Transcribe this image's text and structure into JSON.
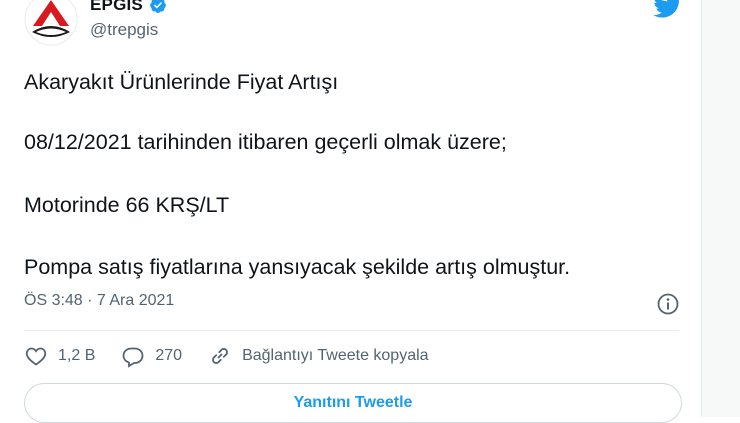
{
  "tweet": {
    "author_name": "EPGIS",
    "author_handle": "@trepgis",
    "lines": [
      "Akaryakıt Ürünlerinde Fiyat Artışı",
      "08/12/2021 tarihinden itibaren geçerli olmak üzere;",
      "Motorinde 66 KRŞ/LT",
      "Pompa satış fiyatlarına yansıyacak şekilde artış olmuştur."
    ],
    "timestamp": "ÖS 3:48 · 7 Ara 2021"
  },
  "actions": {
    "likes": "1,2 B",
    "replies": "270",
    "copy_link": "Bağlantıyı Tweete kopyala"
  },
  "reply_button": "Yanıtını Tweetle",
  "colors": {
    "accent": "#1d9bf0",
    "logo_red": "#d71920",
    "text_secondary": "#536471"
  },
  "icons": [
    "verified-badge-icon",
    "twitter-bird-icon",
    "info-icon",
    "heart-icon",
    "reply-icon",
    "link-icon"
  ]
}
